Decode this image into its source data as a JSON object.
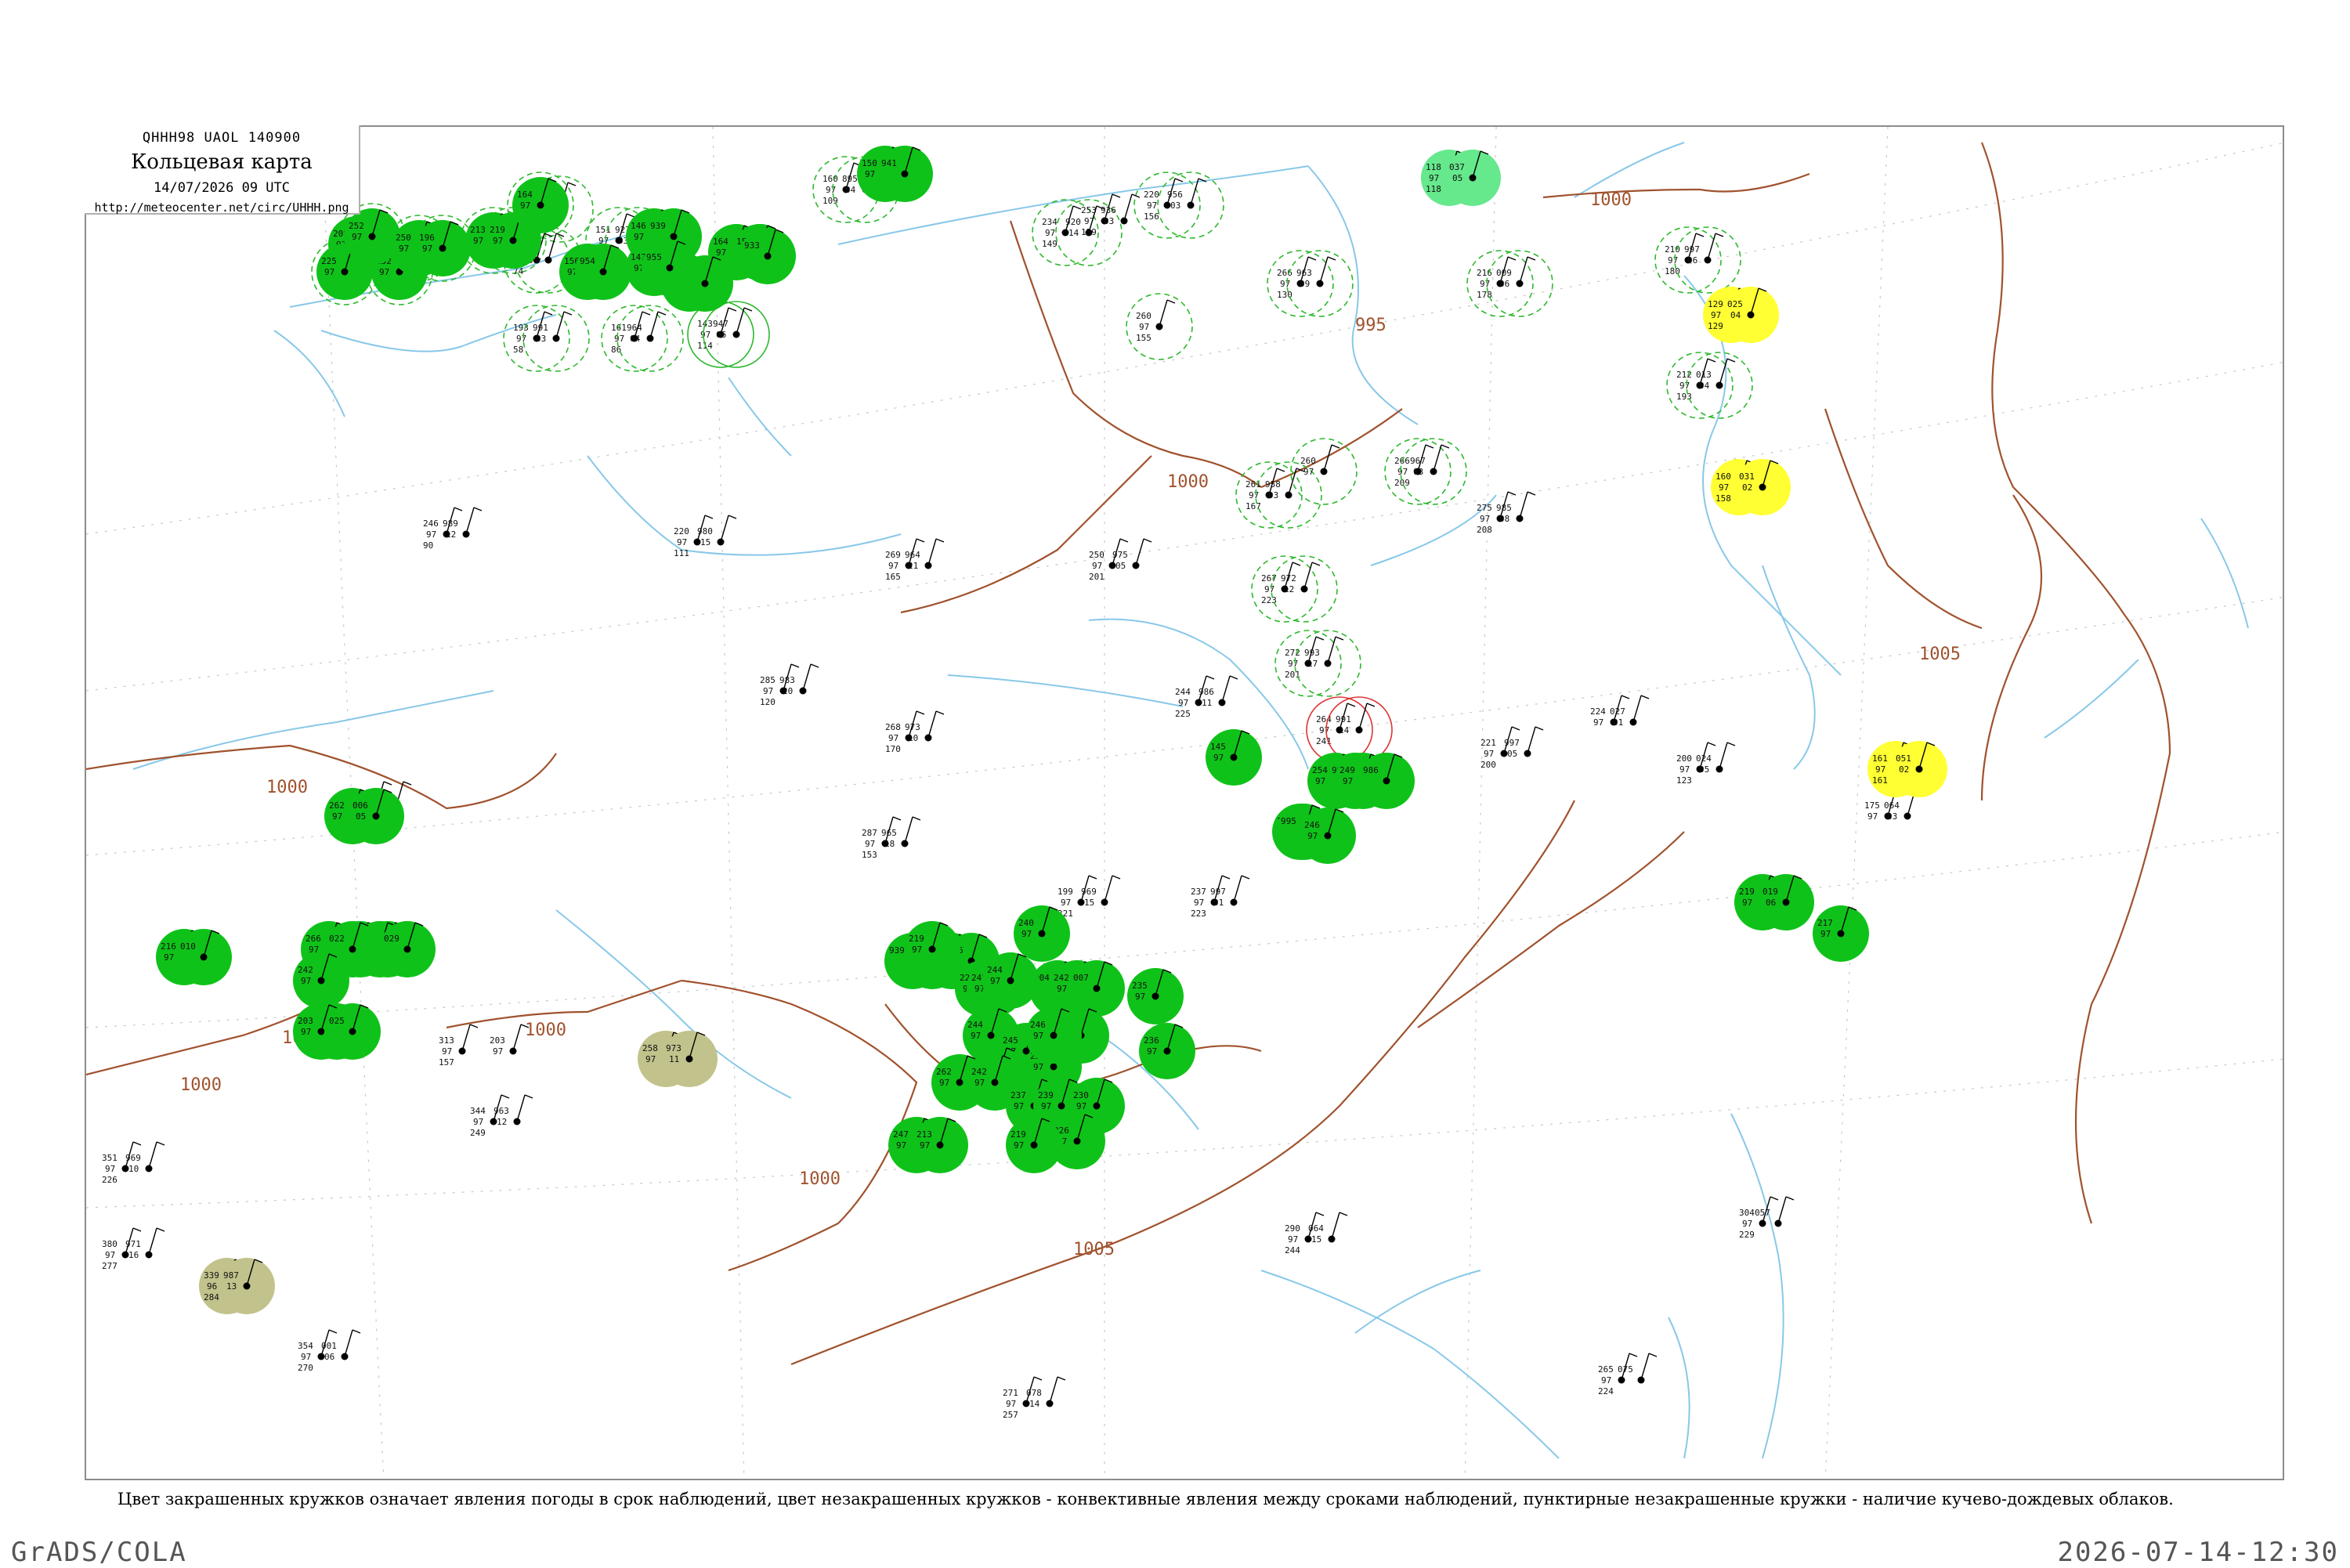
{
  "header": {
    "code": "QHHH98  UAOL  140900",
    "title": "Кольцевая карта",
    "datetime": "14/07/2026 09 UTC",
    "url": "http://meteocenter.net/circ/UHHH.png"
  },
  "caption": "Цвет закрашенных кружков означает явления погоды в срок наблюдений, цвет незакрашенных кружков - конвективные явления между сроками наблюдений, пунктирные незакрашенные кружки - наличие кучево-дождевых облаков.",
  "footer": {
    "left": "GrADS/COLA",
    "right": "2026-07-14-12:30"
  },
  "colors": {
    "precip_green": "#0fc219",
    "cb_dashed": "#2db82d",
    "yellow": "#ffff33",
    "olive": "#c2c28c",
    "light_green": "#66e88c",
    "isobar": "#a0522d",
    "river": "#88c8e8",
    "grid": "#c8c8c8"
  },
  "isobars": [
    {
      "label": "1000"
    },
    {
      "label": "1000"
    },
    {
      "label": "1000"
    },
    {
      "label": "1000"
    },
    {
      "label": "1000"
    },
    {
      "label": "1000"
    },
    {
      "label": "995"
    },
    {
      "label": "995"
    },
    {
      "label": "1005"
    },
    {
      "label": "1005"
    },
    {
      "label": "1000"
    }
  ],
  "stations": [
    {
      "p": "230",
      "t": "97",
      "d": "86",
      "kind": "plain"
    },
    {
      "p": "203",
      "t": "97",
      "d": "71",
      "kind": "cb"
    },
    {
      "p": "021",
      "t": "04",
      "d": "",
      "kind": "cb"
    },
    {
      "p": "122",
      "t": "97",
      "d": "64",
      "kind": "cb"
    },
    {
      "p": "170",
      "t": "97",
      "d": "75",
      "kind": "cb"
    },
    {
      "p": "005",
      "t": "02",
      "d": "71",
      "kind": "cb"
    },
    {
      "p": "148",
      "t": "97",
      "d": "82",
      "kind": "cb"
    },
    {
      "p": "972",
      "t": "01",
      "d": "",
      "kind": "cb"
    },
    {
      "p": "156",
      "t": "97",
      "d": "83",
      "kind": "cb"
    },
    {
      "p": "938",
      "t": "03",
      "d": "",
      "kind": "cb"
    },
    {
      "p": "151",
      "t": "97",
      "d": "117",
      "kind": "cb"
    },
    {
      "p": "927",
      "t": "03",
      "d": "",
      "kind": "cb"
    },
    {
      "p": "173",
      "t": "97",
      "d": "74",
      "kind": "cb"
    },
    {
      "p": "975",
      "t": "04",
      "d": "",
      "kind": "cb"
    },
    {
      "p": "161",
      "t": "97",
      "d": "86",
      "kind": "cb"
    },
    {
      "p": "964",
      "t": "04",
      "d": "",
      "kind": "cb"
    },
    {
      "p": "143",
      "t": "97",
      "d": "114",
      "kind": "ring"
    },
    {
      "p": "947",
      "t": "06",
      "d": "",
      "kind": "ring"
    },
    {
      "p": "193",
      "t": "97",
      "d": "58",
      "kind": "cb"
    },
    {
      "p": "991",
      "t": "03",
      "d": "",
      "kind": "cb"
    },
    {
      "p": "160",
      "t": "97",
      "d": "109",
      "kind": "cb"
    },
    {
      "p": "895",
      "t": "04",
      "d": "",
      "kind": "cb"
    },
    {
      "p": "234",
      "t": "97",
      "d": "149",
      "kind": "cb"
    },
    {
      "p": "920",
      "t": "14",
      "d": "",
      "kind": "cb"
    },
    {
      "p": "220",
      "t": "97",
      "d": "156",
      "kind": "cb"
    },
    {
      "p": "956",
      "t": "03",
      "d": "",
      "kind": "cb"
    },
    {
      "p": "253",
      "t": "97",
      "d": "159",
      "kind": "plain"
    },
    {
      "p": "936",
      "t": "03",
      "d": "",
      "kind": "plain"
    },
    {
      "p": "266",
      "t": "97",
      "d": "130",
      "kind": "cb"
    },
    {
      "p": "963",
      "t": "09",
      "d": "",
      "kind": "cb"
    },
    {
      "p": "216",
      "t": "97",
      "d": "178",
      "kind": "cb"
    },
    {
      "p": "009",
      "t": "06",
      "d": "",
      "kind": "cb"
    },
    {
      "p": "260",
      "t": "97",
      "d": "155",
      "kind": "cb"
    },
    {
      "p": "261",
      "t": "97",
      "d": "167",
      "kind": "cb"
    },
    {
      "p": "958",
      "t": "03",
      "d": "",
      "kind": "cb"
    },
    {
      "p": "267",
      "t": "97",
      "d": "223",
      "kind": "cb"
    },
    {
      "p": "972",
      "t": "12",
      "d": "",
      "kind": "cb"
    },
    {
      "p": "260",
      "t": "97",
      "d": "",
      "kind": "cb"
    },
    {
      "p": "266",
      "t": "97",
      "d": "209",
      "kind": "cb"
    },
    {
      "p": "967",
      "t": "03",
      "d": "",
      "kind": "cb"
    },
    {
      "p": "275",
      "t": "97",
      "d": "208",
      "kind": "plain"
    },
    {
      "p": "985",
      "t": "08",
      "d": "",
      "kind": "plain"
    },
    {
      "p": "210",
      "t": "97",
      "d": "180",
      "kind": "cb"
    },
    {
      "p": "997",
      "t": "06",
      "d": "",
      "kind": "cb"
    },
    {
      "p": "212",
      "t": "97",
      "d": "193",
      "kind": "cb"
    },
    {
      "p": "013",
      "t": "04",
      "d": "",
      "kind": "cb"
    },
    {
      "p": "246",
      "t": "97",
      "d": "90",
      "kind": "plain"
    },
    {
      "p": "989",
      "t": "12",
      "d": "",
      "kind": "plain"
    },
    {
      "p": "220",
      "t": "97",
      "d": "111",
      "kind": "plain"
    },
    {
      "p": "980",
      "t": "15",
      "d": "",
      "kind": "plain"
    },
    {
      "p": "269",
      "t": "97",
      "d": "165",
      "kind": "plain"
    },
    {
      "p": "964",
      "t": "21",
      "d": "",
      "kind": "plain"
    },
    {
      "p": "250",
      "t": "97",
      "d": "201",
      "kind": "plain"
    },
    {
      "p": "975",
      "t": "05",
      "d": "",
      "kind": "plain"
    },
    {
      "p": "272",
      "t": "97",
      "d": "201",
      "kind": "cb"
    },
    {
      "p": "993",
      "t": "17",
      "d": "",
      "kind": "cb"
    },
    {
      "p": "264",
      "t": "97",
      "d": "241",
      "kind": "ring-red"
    },
    {
      "p": "991",
      "t": "14",
      "d": "",
      "kind": "ring-red"
    },
    {
      "p": "221",
      "t": "97",
      "d": "200",
      "kind": "plain"
    },
    {
      "p": "997",
      "t": "05",
      "d": "",
      "kind": "plain"
    },
    {
      "p": "285",
      "t": "97",
      "d": "120",
      "kind": "plain"
    },
    {
      "p": "983",
      "t": "20",
      "d": "",
      "kind": "plain"
    },
    {
      "p": "268",
      "t": "97",
      "d": "170",
      "kind": "plain"
    },
    {
      "p": "973",
      "t": "10",
      "d": "",
      "kind": "plain"
    },
    {
      "p": "244",
      "t": "97",
      "d": "225",
      "kind": "plain"
    },
    {
      "p": "986",
      "t": "11",
      "d": "",
      "kind": "plain"
    },
    {
      "p": "264",
      "t": "97",
      "d": "113",
      "kind": "plain"
    },
    {
      "p": "006",
      "t": "06",
      "d": "",
      "kind": "plain"
    },
    {
      "p": "287",
      "t": "97",
      "d": "153",
      "kind": "plain"
    },
    {
      "p": "965",
      "t": "18",
      "d": "",
      "kind": "plain"
    },
    {
      "p": "199",
      "t": "97",
      "d": "221",
      "kind": "plain"
    },
    {
      "p": "969",
      "t": "15",
      "d": "",
      "kind": "plain"
    },
    {
      "p": "237",
      "t": "97",
      "d": "223",
      "kind": "plain"
    },
    {
      "p": "997",
      "t": "01",
      "d": "",
      "kind": "plain"
    },
    {
      "p": "200",
      "t": "97",
      "d": "123",
      "kind": "plain"
    },
    {
      "p": "024",
      "t": "05",
      "d": "",
      "kind": "plain"
    },
    {
      "p": "313",
      "t": "97",
      "d": "157",
      "kind": "plain"
    },
    {
      "p": "203",
      "t": "97",
      "d": "",
      "kind": "plain"
    },
    {
      "p": "344",
      "t": "97",
      "d": "249",
      "kind": "plain"
    },
    {
      "p": "963",
      "t": "12",
      "d": "",
      "kind": "plain"
    },
    {
      "p": "351",
      "t": "97",
      "d": "226",
      "kind": "plain"
    },
    {
      "p": "969",
      "t": "10",
      "d": "",
      "kind": "plain"
    },
    {
      "p": "380",
      "t": "97",
      "d": "277",
      "kind": "plain"
    },
    {
      "p": "971",
      "t": "16",
      "d": "",
      "kind": "plain"
    },
    {
      "p": "354",
      "t": "97",
      "d": "270",
      "kind": "plain"
    },
    {
      "p": "001",
      "t": "06",
      "d": "",
      "kind": "plain"
    },
    {
      "p": "290",
      "t": "97",
      "d": "244",
      "kind": "plain"
    },
    {
      "p": "064",
      "t": "15",
      "d": "",
      "kind": "plain"
    },
    {
      "p": "304",
      "t": "97",
      "d": "229",
      "kind": "plain"
    },
    {
      "p": "057",
      "t": "",
      "d": "",
      "kind": "plain"
    },
    {
      "p": "265",
      "t": "97",
      "d": "224",
      "kind": "plain"
    },
    {
      "p": "075",
      "t": "",
      "d": "",
      "kind": "plain"
    },
    {
      "p": "271",
      "t": "97",
      "d": "257",
      "kind": "plain"
    },
    {
      "p": "078",
      "t": "14",
      "d": "",
      "kind": "plain"
    },
    {
      "p": "224",
      "t": "97",
      "d": "",
      "kind": "plain"
    },
    {
      "p": "027",
      "t": "01",
      "d": "",
      "kind": "plain"
    },
    {
      "p": "175",
      "t": "97",
      "d": "",
      "kind": "plain"
    },
    {
      "p": "064",
      "t": "03",
      "d": "",
      "kind": "plain"
    },
    {
      "p": "129",
      "t": "97",
      "d": "129",
      "kind": "yellow"
    },
    {
      "p": "025",
      "t": "04",
      "d": "",
      "kind": "yellow"
    },
    {
      "p": "160",
      "t": "97",
      "d": "158",
      "kind": "yellow"
    },
    {
      "p": "031",
      "t": "02",
      "d": "",
      "kind": "yellow"
    },
    {
      "p": "161",
      "t": "97",
      "d": "161",
      "kind": "yellow"
    },
    {
      "p": "051",
      "t": "02",
      "d": "",
      "kind": "yellow"
    },
    {
      "p": "118",
      "t": "97",
      "d": "118",
      "kind": "lightgreen"
    },
    {
      "p": "037",
      "t": "05",
      "d": "",
      "kind": "lightgreen"
    },
    {
      "p": "339",
      "t": "96",
      "d": "284",
      "kind": "olive"
    },
    {
      "p": "987",
      "t": "13",
      "d": "",
      "kind": "olive"
    },
    {
      "p": "258",
      "t": "97",
      "d": "",
      "kind": "olive"
    },
    {
      "p": "973",
      "t": "11",
      "d": "",
      "kind": "olive"
    },
    {
      "p": "262",
      "t": "97",
      "d": "",
      "kind": "green"
    },
    {
      "p": "006",
      "t": "05",
      "d": "",
      "kind": "green"
    },
    {
      "p": "219",
      "t": "97",
      "d": "",
      "kind": "green"
    },
    {
      "p": "019",
      "t": "06",
      "d": "",
      "kind": "green"
    },
    {
      "p": "231",
      "t": "97",
      "d": "",
      "kind": "green"
    },
    {
      "p": "02",
      "t": "",
      "d": "",
      "kind": "green"
    },
    {
      "p": "265",
      "t": "97",
      "d": "",
      "kind": "green"
    },
    {
      "p": "029",
      "t": "",
      "d": "",
      "kind": "green"
    },
    {
      "p": "266",
      "t": "97",
      "d": "",
      "kind": "green"
    },
    {
      "p": "022",
      "t": "",
      "d": "",
      "kind": "green"
    },
    {
      "p": "242",
      "t": "97",
      "d": "",
      "kind": "green"
    },
    {
      "p": "211",
      "t": "97",
      "d": "",
      "kind": "green"
    },
    {
      "p": "203",
      "t": "97",
      "d": "",
      "kind": "green"
    },
    {
      "p": "025",
      "t": "",
      "d": "",
      "kind": "green"
    },
    {
      "p": "216",
      "t": "97",
      "d": "",
      "kind": "green"
    },
    {
      "p": "010",
      "t": "",
      "d": "",
      "kind": "green"
    },
    {
      "p": "150",
      "t": "97",
      "d": "",
      "kind": "green"
    },
    {
      "p": "941",
      "t": "",
      "d": "",
      "kind": "green"
    },
    {
      "p": "146",
      "t": "97",
      "d": "",
      "kind": "green"
    },
    {
      "p": "939",
      "t": "",
      "d": "",
      "kind": "green"
    },
    {
      "p": "164",
      "t": "97",
      "d": "",
      "kind": "green"
    },
    {
      "p": "957",
      "t": "",
      "d": "",
      "kind": "green"
    },
    {
      "p": "150",
      "t": "97",
      "d": "",
      "kind": "green"
    },
    {
      "p": "933",
      "t": "",
      "d": "",
      "kind": "green"
    },
    {
      "p": "141",
      "t": "97",
      "d": "",
      "kind": "green"
    },
    {
      "p": "935",
      "t": "",
      "d": "",
      "kind": "green"
    },
    {
      "p": "156",
      "t": "97",
      "d": "",
      "kind": "green"
    },
    {
      "p": "954",
      "t": "",
      "d": "",
      "kind": "green"
    },
    {
      "p": "147",
      "t": "97",
      "d": "",
      "kind": "green"
    },
    {
      "p": "955",
      "t": "",
      "d": "",
      "kind": "green"
    },
    {
      "p": "145",
      "t": "97",
      "d": "",
      "kind": "green"
    },
    {
      "p": "939",
      "t": "",
      "d": "",
      "kind": "green"
    },
    {
      "p": "275",
      "t": "97",
      "d": "",
      "kind": "green"
    },
    {
      "p": "255",
      "t": "97",
      "d": "",
      "kind": "green"
    },
    {
      "p": "995",
      "t": "",
      "d": "",
      "kind": "green"
    },
    {
      "p": "254",
      "t": "97",
      "d": "",
      "kind": "green"
    },
    {
      "p": "998",
      "t": "",
      "d": "",
      "kind": "green"
    },
    {
      "p": "249",
      "t": "97",
      "d": "",
      "kind": "green"
    },
    {
      "p": "986",
      "t": "",
      "d": "",
      "kind": "green"
    },
    {
      "p": "257",
      "t": "97",
      "d": "",
      "kind": "green"
    },
    {
      "p": "995",
      "t": "",
      "d": "",
      "kind": "green"
    },
    {
      "p": "246",
      "t": "97",
      "d": "",
      "kind": "green"
    },
    {
      "p": "240",
      "t": "97",
      "d": "",
      "kind": "green"
    },
    {
      "p": "004",
      "t": "",
      "d": "",
      "kind": "green"
    },
    {
      "p": "242",
      "t": "97",
      "d": "",
      "kind": "green"
    },
    {
      "p": "007",
      "t": "",
      "d": "",
      "kind": "green"
    },
    {
      "p": "221",
      "t": "97",
      "d": "",
      "kind": "green"
    },
    {
      "p": "245",
      "t": "97",
      "d": "",
      "kind": "green"
    },
    {
      "p": "244",
      "t": "97",
      "d": "",
      "kind": "green"
    },
    {
      "p": "244",
      "t": "97",
      "d": "",
      "kind": "green"
    },
    {
      "p": "245",
      "t": "97",
      "d": "",
      "kind": "green"
    },
    {
      "p": "237",
      "t": "97",
      "d": "",
      "kind": "green"
    },
    {
      "p": "247",
      "t": "97",
      "d": "",
      "kind": "green"
    },
    {
      "p": "245",
      "t": "97",
      "d": "",
      "kind": "green"
    },
    {
      "p": "246",
      "t": "97",
      "d": "",
      "kind": "green"
    },
    {
      "p": "262",
      "t": "97",
      "d": "",
      "kind": "green"
    },
    {
      "p": "242",
      "t": "97",
      "d": "",
      "kind": "green"
    },
    {
      "p": "237",
      "t": "97",
      "d": "",
      "kind": "green"
    },
    {
      "p": "239",
      "t": "97",
      "d": "",
      "kind": "green"
    },
    {
      "p": "230",
      "t": "97",
      "d": "",
      "kind": "green"
    },
    {
      "p": "235",
      "t": "97",
      "d": "",
      "kind": "green"
    },
    {
      "p": "236",
      "t": "97",
      "d": "",
      "kind": "green"
    },
    {
      "p": "226",
      "t": "97",
      "d": "",
      "kind": "green"
    },
    {
      "p": "219",
      "t": "97",
      "d": "",
      "kind": "green"
    },
    {
      "p": "247",
      "t": "97",
      "d": "",
      "kind": "green"
    },
    {
      "p": "213",
      "t": "97",
      "d": "",
      "kind": "green"
    },
    {
      "p": "219",
      "t": "97",
      "d": "",
      "kind": "green"
    },
    {
      "p": "217",
      "t": "97",
      "d": "",
      "kind": "green"
    },
    {
      "p": "208",
      "t": "97",
      "d": "",
      "kind": "green"
    },
    {
      "p": "225",
      "t": "97",
      "d": "",
      "kind": "green"
    },
    {
      "p": "252",
      "t": "97",
      "d": "",
      "kind": "green"
    },
    {
      "p": "252",
      "t": "97",
      "d": "",
      "kind": "green"
    },
    {
      "p": "250",
      "t": "97",
      "d": "",
      "kind": "green"
    },
    {
      "p": "196",
      "t": "97",
      "d": "",
      "kind": "green"
    },
    {
      "p": "213",
      "t": "97",
      "d": "",
      "kind": "green"
    },
    {
      "p": "219",
      "t": "97",
      "d": "",
      "kind": "green"
    },
    {
      "p": "164",
      "t": "97",
      "d": "",
      "kind": "green"
    }
  ]
}
